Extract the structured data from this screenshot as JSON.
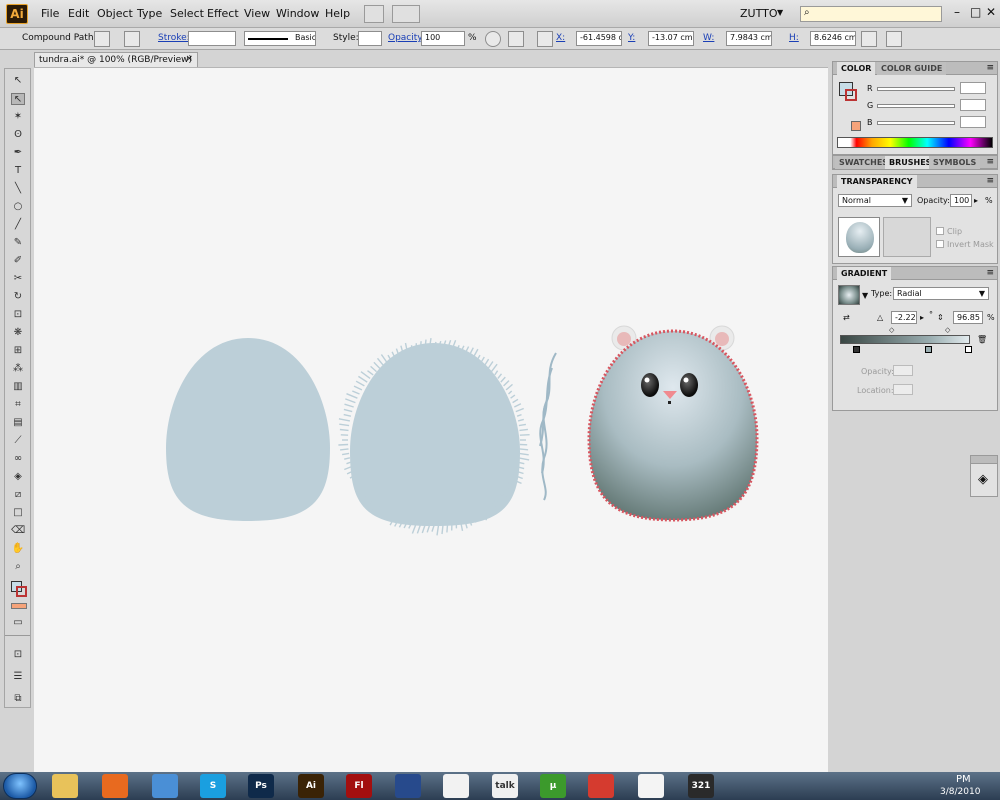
{
  "app": {
    "logo": "Ai",
    "workspace": "ZUTTO"
  },
  "menu": [
    "File",
    "Edit",
    "Object",
    "Type",
    "Select",
    "Effect",
    "View",
    "Window",
    "Help"
  ],
  "control_bar": {
    "selection_type": "Compound Path",
    "stroke_label": "Stroke:",
    "brush_style": "Basic",
    "style_label": "Style:",
    "opacity_label": "Opacity:",
    "opacity_value": "100",
    "percent": "%",
    "x_label": "X:",
    "x_value": "-61.4598 cm",
    "y_label": "Y:",
    "y_value": "-13.07 cm",
    "w_label": "W:",
    "w_value": "7.9843 cm",
    "h_label": "H:",
    "h_value": "8.6246 cm"
  },
  "document": {
    "tab_title": "tundra.ai* @ 100% (RGB/Preview)",
    "close": "×"
  },
  "color_panel": {
    "tabs": [
      "COLOR",
      "COLOR GUIDE"
    ],
    "channels": [
      "R",
      "G",
      "B"
    ],
    "fill_color": "#c7dde7",
    "accent_swatch": "#f5a37a"
  },
  "swatch_panel": {
    "tabs": [
      "SWATCHES",
      "BRUSHES",
      "SYMBOLS"
    ]
  },
  "transparency_panel": {
    "title": "TRANSPARENCY",
    "blend_mode": "Normal",
    "opacity_label": "Opacity:",
    "opacity_value": "100",
    "percent": "%",
    "clip_label": "Clip",
    "invert_mask_label": "Invert Mask"
  },
  "gradient_panel": {
    "title": "GRADIENT",
    "type_label": "Type:",
    "type_value": "Radial",
    "angle_value": "-2.22",
    "degree": "°",
    "aspect_value": "96.85",
    "percent": "%",
    "opacity_label": "Opacity:",
    "location_label": "Location:"
  },
  "taskbar": {
    "apps": [
      {
        "name": "explorer",
        "label": "",
        "color": "#e8c25a"
      },
      {
        "name": "firefox",
        "label": "",
        "color": "#e86a1f"
      },
      {
        "name": "browser",
        "label": "",
        "color": "#4a8fd6"
      },
      {
        "name": "skype",
        "label": "S",
        "color": "#1a9fe0"
      },
      {
        "name": "photoshop",
        "label": "Ps",
        "color": "#0f2a4a"
      },
      {
        "name": "illustrator",
        "label": "Ai",
        "color": "#3a2306"
      },
      {
        "name": "flash",
        "label": "Fl",
        "color": "#a30f0f"
      },
      {
        "name": "save",
        "label": "",
        "color": "#274a8c"
      },
      {
        "name": "runner",
        "label": "",
        "color": "#f2f2f2"
      },
      {
        "name": "gtalk",
        "label": "talk",
        "color": "#f0f0f0"
      },
      {
        "name": "utorrent",
        "label": "µ",
        "color": "#3c9a2c"
      },
      {
        "name": "chrome",
        "label": "",
        "color": "#d53b2f"
      },
      {
        "name": "acrobat",
        "label": "",
        "color": "#f4f4f4"
      },
      {
        "name": "media",
        "label": "321",
        "color": "#2a2a2a"
      }
    ],
    "clock_time": "PM",
    "clock_date": "3/8/2010"
  }
}
